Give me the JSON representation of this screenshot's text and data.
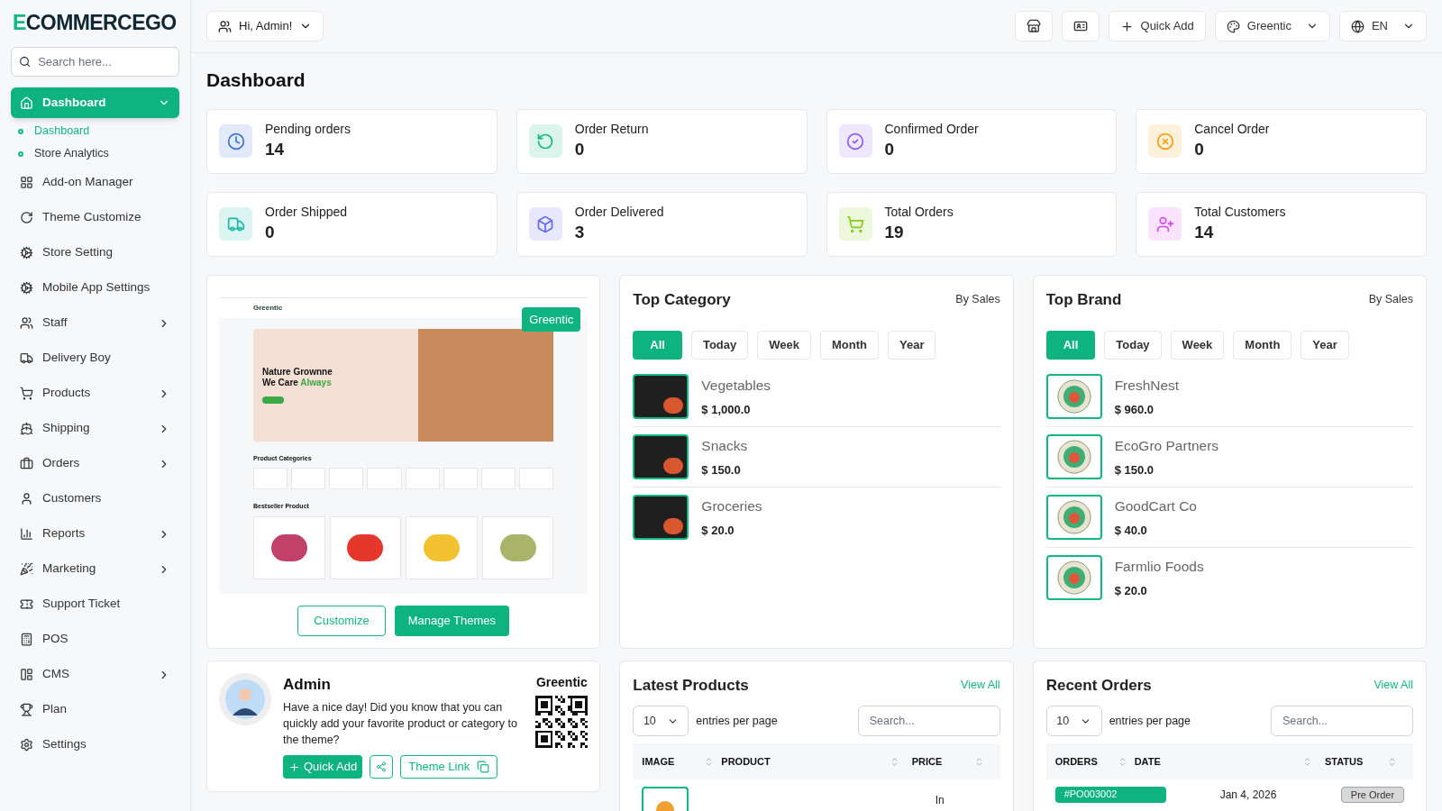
{
  "brand": {
    "logo_first": "E",
    "logo_rest": "COMMERCEGO"
  },
  "search": {
    "placeholder": "Search here..."
  },
  "sidebar": {
    "items": [
      {
        "label": "Dashboard",
        "selected": true,
        "expandable": true,
        "expanded": true,
        "children": [
          {
            "label": "Dashboard",
            "selected": true
          },
          {
            "label": "Store Analytics",
            "selected": false
          }
        ]
      },
      {
        "label": "Add-on Manager",
        "selected": false,
        "expandable": false
      },
      {
        "label": "Theme Customize",
        "selected": false,
        "expandable": false
      },
      {
        "label": "Store Setting",
        "selected": false,
        "expandable": false
      },
      {
        "label": "Mobile App Settings",
        "selected": false,
        "expandable": false
      },
      {
        "label": "Staff",
        "selected": false,
        "expandable": true,
        "expanded": false
      },
      {
        "label": "Delivery Boy",
        "selected": false,
        "expandable": false
      },
      {
        "label": "Products",
        "selected": false,
        "expandable": true,
        "expanded": false
      },
      {
        "label": "Shipping",
        "selected": false,
        "expandable": true,
        "expanded": false
      },
      {
        "label": "Orders",
        "selected": false,
        "expandable": true,
        "expanded": false
      },
      {
        "label": "Customers",
        "selected": false,
        "expandable": false
      },
      {
        "label": "Reports",
        "selected": false,
        "expandable": true,
        "expanded": false
      },
      {
        "label": "Marketing",
        "selected": false,
        "expandable": true,
        "expanded": false
      },
      {
        "label": "Support Ticket",
        "selected": false,
        "expandable": false
      },
      {
        "label": "POS",
        "selected": false,
        "expandable": false
      },
      {
        "label": "CMS",
        "selected": false,
        "expandable": true,
        "expanded": false
      },
      {
        "label": "Plan",
        "selected": false,
        "expandable": false
      },
      {
        "label": "Settings",
        "selected": false,
        "expandable": false
      }
    ]
  },
  "header": {
    "user_menu": "Hi, Admin!",
    "quick_add": "Quick Add",
    "theme_menu": "Greentic",
    "language_menu": "EN"
  },
  "page_title": "Dashboard",
  "stats": [
    {
      "label": "Pending orders",
      "value": "14",
      "color": "#3b6fd4"
    },
    {
      "label": "Order Return",
      "value": "0",
      "color": "#10b981"
    },
    {
      "label": "Confirmed Order",
      "value": "0",
      "color": "#8b5cf6"
    },
    {
      "label": "Cancel Order",
      "value": "0",
      "color": "#f59e0b"
    },
    {
      "label": "Order Shipped",
      "value": "0",
      "color": "#14b8a6"
    },
    {
      "label": "Order Delivered",
      "value": "3",
      "color": "#6366f1"
    },
    {
      "label": "Total Orders",
      "value": "19",
      "color": "#84cc16"
    },
    {
      "label": "Total Customers",
      "value": "14",
      "color": "#d946ef"
    }
  ],
  "theme_card": {
    "badge": "Greentic",
    "preview": {
      "logo": "Greentic",
      "hero_line1": "Nature Grownne",
      "hero_line2": "We Care",
      "hero_highlight": "Always",
      "categories_title": "Product Categories",
      "bestseller_title": "Bestseller Product"
    },
    "buttons": [
      "Customize",
      "Manage Themes"
    ]
  },
  "top_category": {
    "title": "Top Category",
    "subtitle": "By Sales",
    "tabs": [
      {
        "label": "All",
        "selected": true
      },
      {
        "label": "Today",
        "selected": false
      },
      {
        "label": "Week",
        "selected": false
      },
      {
        "label": "Month",
        "selected": false
      },
      {
        "label": "Year",
        "selected": false
      }
    ],
    "items": [
      {
        "name": "Vegetables",
        "amount": "$ 1,000.0"
      },
      {
        "name": "Snacks",
        "amount": "$ 150.0"
      },
      {
        "name": "Groceries",
        "amount": "$ 20.0"
      }
    ]
  },
  "top_brand": {
    "title": "Top Brand",
    "subtitle": "By Sales",
    "tabs": [
      {
        "label": "All",
        "selected": true
      },
      {
        "label": "Today",
        "selected": false
      },
      {
        "label": "Week",
        "selected": false
      },
      {
        "label": "Month",
        "selected": false
      },
      {
        "label": "Year",
        "selected": false
      }
    ],
    "items": [
      {
        "name": "FreshNest",
        "amount": "$ 960.0"
      },
      {
        "name": "EcoGro Partners",
        "amount": "$ 150.0"
      },
      {
        "name": "GoodCart Co",
        "amount": "$ 40.0"
      },
      {
        "name": "Farmlio Foods",
        "amount": "$ 20.0"
      }
    ]
  },
  "admin_card": {
    "name": "Admin",
    "message": "Have a nice day! Did you know that you can quickly add your favorite product or category to the theme?",
    "store": "Greentic",
    "quick_add": "Quick Add",
    "theme_link": "Theme Link"
  },
  "latest_products": {
    "title": "Latest Products",
    "view_all": "View All",
    "entries": "10",
    "entries_label": "entries per page",
    "search_placeholder": "Search...",
    "columns": [
      "IMAGE",
      "PRODUCT",
      "PRICE"
    ],
    "rows": [
      {
        "price": "In"
      }
    ]
  },
  "recent_orders": {
    "title": "Recent Orders",
    "view_all": "View All",
    "entries": "10",
    "entries_label": "entries per page",
    "search_placeholder": "Search...",
    "columns": [
      "ORDERS",
      "DATE",
      "STATUS"
    ],
    "rows": [
      {
        "order": "#PO003002",
        "date": "Jan 4, 2026",
        "status": "Pre Order"
      }
    ]
  }
}
